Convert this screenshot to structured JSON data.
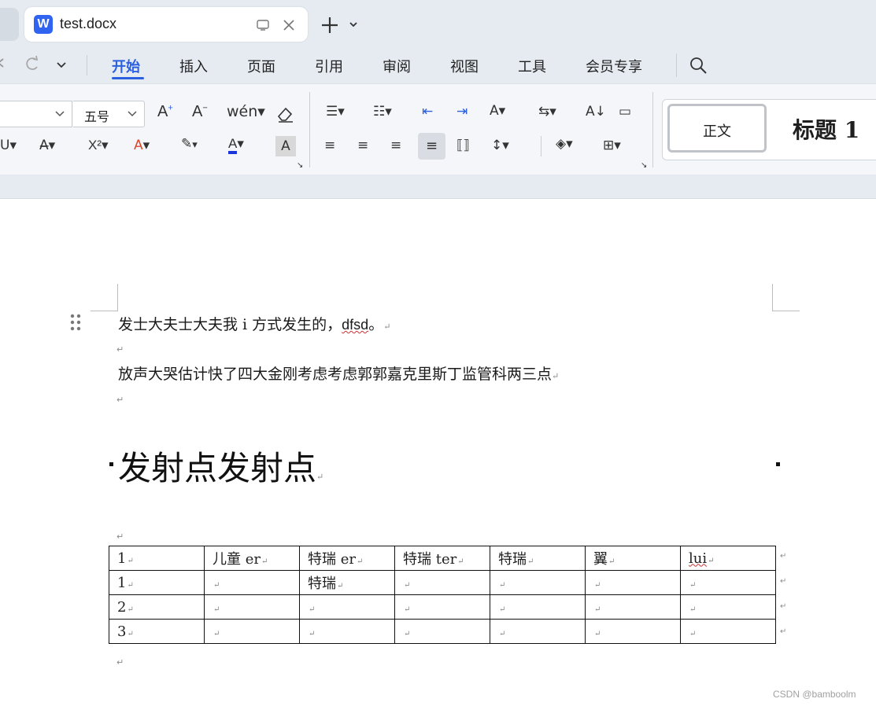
{
  "tab": {
    "title": "test.docx",
    "logo": "W"
  },
  "menu": {
    "items": [
      "开始",
      "插入",
      "页面",
      "引用",
      "审阅",
      "视图",
      "工具",
      "会员专享"
    ],
    "active": "开始"
  },
  "ribbon": {
    "font_size": "五号",
    "styles": {
      "normal": "正文",
      "heading1": "标题 1"
    }
  },
  "document": {
    "paragraphs": [
      {
        "text": "发士大夫士大夫我 i 方式发生的，",
        "suffix": "dfsd",
        "end": "。"
      },
      {
        "text": "放声大哭估计快了四大金刚考虑考虑郭郭嘉克里斯丁监管科两三点"
      }
    ],
    "heading": "发射点发射点",
    "table": {
      "rows": [
        [
          "1",
          "儿童 er",
          "特瑞 er",
          "特瑞 ter",
          "特瑞",
          "翼",
          "lui"
        ],
        [
          "1",
          "",
          "特瑞",
          "",
          "",
          "",
          ""
        ],
        [
          "2",
          "",
          "",
          "",
          "",
          "",
          ""
        ],
        [
          "3",
          "",
          "",
          "",
          "",
          "",
          ""
        ]
      ]
    }
  },
  "watermark": "CSDN @bamboolm",
  "colors": {
    "accent": "#2c5fe0",
    "logo": "#2f63f0"
  }
}
